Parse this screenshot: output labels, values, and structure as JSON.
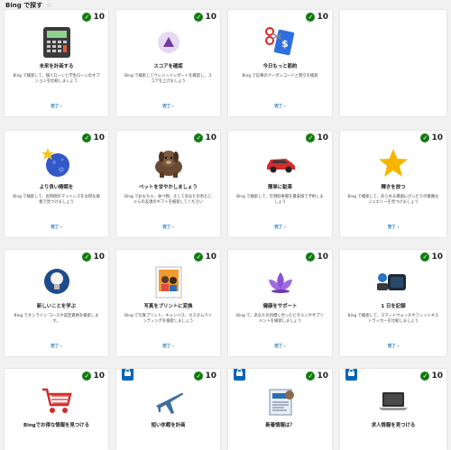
{
  "header": {
    "title": "Bing で探す",
    "icon": "star-outline-icon"
  },
  "cards": [
    {
      "id": "plan-future",
      "points": "10",
      "title": "未来を計画する",
      "desc": "Bing で検索して、個人ローンと学生ローンのオプションを比較しましょう",
      "done": "完了 ›",
      "icon": "calculator-icon",
      "locked": false
    },
    {
      "id": "check-score",
      "points": "10",
      "title": "スコアを確認",
      "desc": "Bing で検索してクレジットレポートを確認し、スコアを上げましょう",
      "done": "完了 ›",
      "icon": "score-badge-icon",
      "locked": false
    },
    {
      "id": "save-today",
      "points": "10",
      "title": "今日もっと節約",
      "desc": "Bing で記事のクーポンコードと割引を検索",
      "done": "完了 ›",
      "icon": "coupon-scissors-icon",
      "locked": false
    },
    {
      "id": "better-sleep",
      "points": "10",
      "title": "より良い睡眠を",
      "desc": "Bing で検索して、長時間のマットレスをお得な価格で見つけましょう",
      "done": "完了 ›",
      "icon": "moon-star-icon",
      "locked": false
    },
    {
      "id": "pet",
      "points": "10",
      "title": "ペットを甘やかしましょう",
      "desc": "Bing でおもちゃ、食べ物、そしてあなたの毛むじゃらの友達のギフトを検索してください",
      "done": "完了 ›",
      "icon": "dog-icon",
      "locked": false
    },
    {
      "id": "parking",
      "points": "10",
      "title": "簡単に駐車",
      "desc": "Bing で検索して、空港駐車場を最安値で予約しましょう",
      "done": "完了 ›",
      "icon": "car-icon",
      "locked": false
    },
    {
      "id": "shine",
      "points": "10",
      "title": "輝きを放つ",
      "desc": "Bing で検索して、あらゆる場面にぴったりの素敵なジュエリーを見つけましょう",
      "done": "完了 ›",
      "icon": "gold-star-icon",
      "locked": false
    },
    {
      "id": "learn-new",
      "points": "10",
      "title": "新しいことを学ぶ",
      "desc": "Bing でオンライン コースや認定資格を検索します。",
      "done": "完了 ›",
      "icon": "lightbulb-icon",
      "locked": false
    },
    {
      "id": "print-photo",
      "points": "10",
      "title": "写真をプリントに変換",
      "desc": "Bing で写真プリント、キャンバス、カスタムペインティングを検索しましょう",
      "done": "完了 ›",
      "icon": "photo-print-icon",
      "locked": false
    },
    {
      "id": "health",
      "points": "10",
      "title": "健康をサポート",
      "desc": "Bing で、あなたの目標に合ったビタミンやサプリメントを検索しましょう",
      "done": "完了 ›",
      "icon": "lotus-icon",
      "locked": false
    },
    {
      "id": "record-day",
      "points": "10",
      "title": "1 日を記録",
      "desc": "Bing で検索して、スマートウォッチやフィットネストラッカーを比較しましょう",
      "done": "完了 ›",
      "icon": "watch-icon",
      "locked": false
    },
    {
      "id": "deals",
      "points": "10",
      "title": "Bingでお得な情報を見つける",
      "desc": "",
      "done": "",
      "icon": "cart-icon",
      "locked": false
    },
    {
      "id": "trip",
      "points": "10",
      "title": "短い休暇を計画",
      "desc": "",
      "done": "",
      "icon": "airplane-icon",
      "locked": true
    },
    {
      "id": "news",
      "points": "10",
      "title": "新着情報は？",
      "desc": "",
      "done": "",
      "icon": "newspaper-icon",
      "locked": true
    },
    {
      "id": "jobs",
      "points": "10",
      "title": "求人情報を見つける",
      "desc": "",
      "done": "",
      "icon": "laptop-icon",
      "locked": true
    }
  ]
}
